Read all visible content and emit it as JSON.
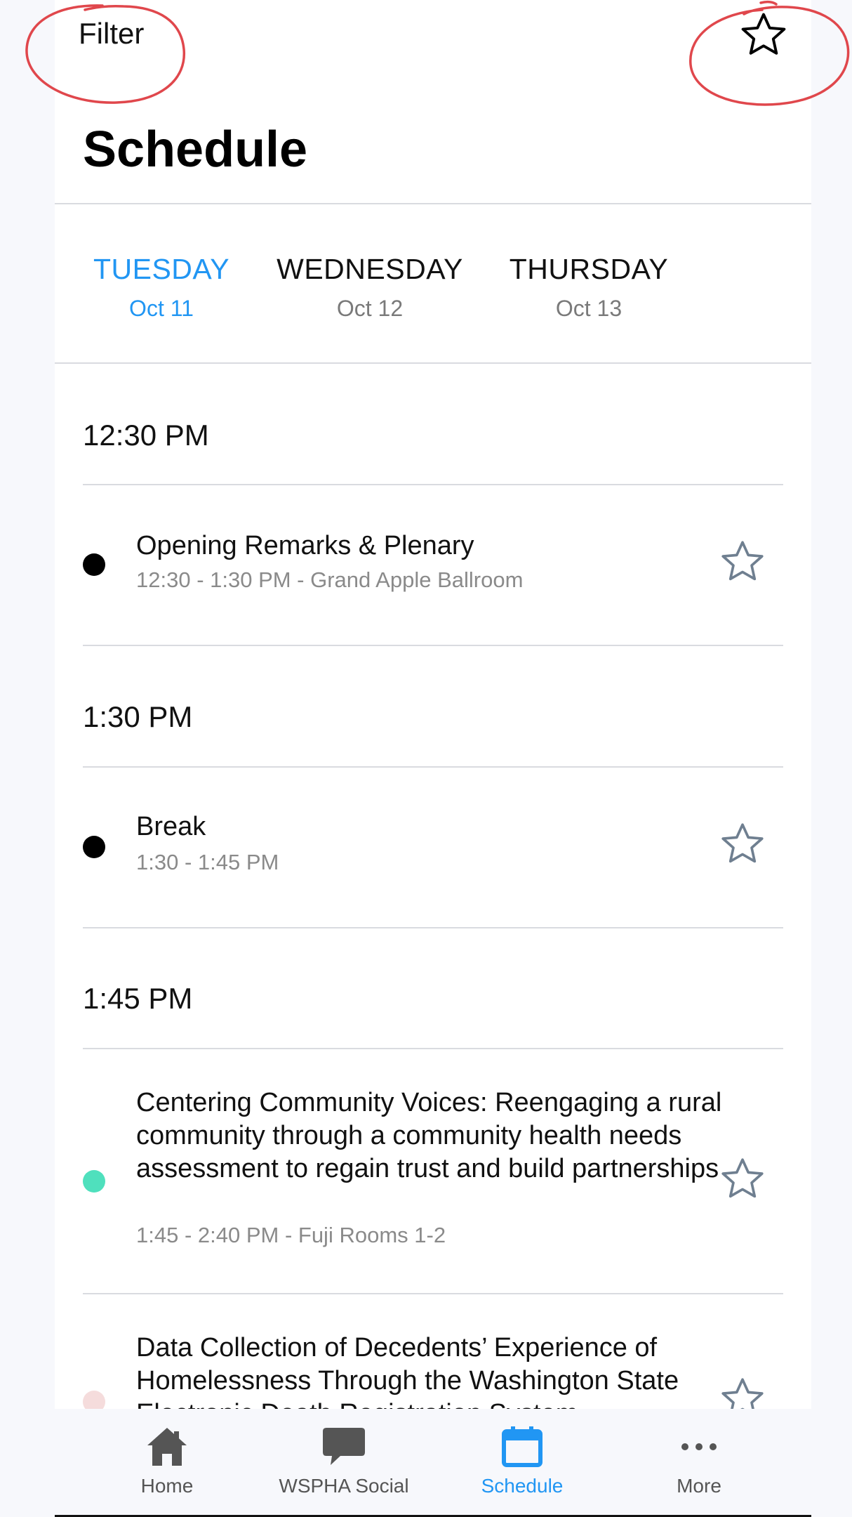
{
  "header": {
    "filter_label": "Filter",
    "favorites_icon": "star-outline-icon",
    "title": "Schedule"
  },
  "day_tabs": [
    {
      "day": "TUESDAY",
      "date": "Oct 11",
      "active": true
    },
    {
      "day": "WEDNESDAY",
      "date": "Oct 12",
      "active": false
    },
    {
      "day": "THURSDAY",
      "date": "Oct 13",
      "active": false
    }
  ],
  "schedule": [
    {
      "time": "12:30 PM",
      "sessions": [
        {
          "title": "Opening Remarks & Plenary",
          "meta": "12:30 - 1:30 PM - Grand Apple Ballroom",
          "dot_color": "#000000"
        }
      ]
    },
    {
      "time": "1:30 PM",
      "sessions": [
        {
          "title": "Break",
          "meta": "1:30 - 1:45 PM",
          "dot_color": "#000000"
        }
      ]
    },
    {
      "time": "1:45 PM",
      "sessions": [
        {
          "title": "Centering Community Voices: Reengaging a rural community through a community health needs assessment to regain trust and build partnerships",
          "meta": "1:45 - 2:40 PM - Fuji Rooms 1-2",
          "dot_color": "#4fe0bd"
        },
        {
          "title": "Data Collection of Decedents’ Experience of Homelessness Through the Washington State Electronic Death Registration System",
          "meta": "",
          "dot_color": "#f5dcdc"
        }
      ]
    }
  ],
  "tab_bar": {
    "items": [
      {
        "label": "Home",
        "icon": "home-icon",
        "active": false
      },
      {
        "label": "WSPHA Social",
        "icon": "chat-bubble-icon",
        "active": false
      },
      {
        "label": "Schedule",
        "icon": "calendar-icon",
        "active": true
      },
      {
        "label": "More",
        "icon": "more-dots-icon",
        "active": false
      }
    ]
  },
  "colors": {
    "accent": "#2196f3",
    "annotation": "#e0474c",
    "text": "#111111",
    "muted": "#8a8a8a",
    "star_outline": "#6f7f90",
    "nav_icon": "#555555"
  }
}
